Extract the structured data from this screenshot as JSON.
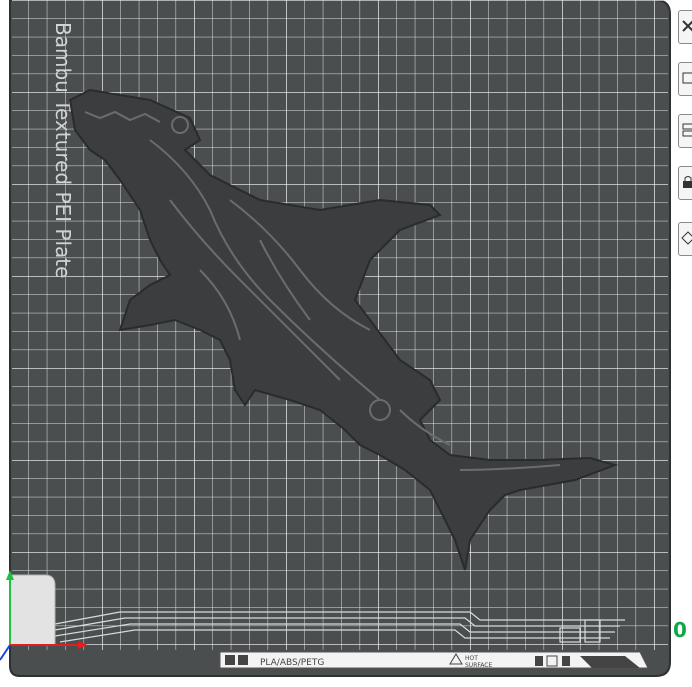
{
  "plate": {
    "name": "Bambu Textured PEI Plate",
    "filament_types": "PLA/ABS/PETG",
    "hot_label_line1": "HOT",
    "hot_label_line2": "SURFACE",
    "colors": {
      "plate": "#4a4e4f",
      "grid": "#e9eceb",
      "model": "#3c3d3e",
      "model_detail": "#6a6d6e",
      "axis_x": "#e02020",
      "axis_y": "#20c040",
      "axis_z": "#2040e0"
    }
  },
  "model": {
    "name": "shark"
  },
  "right_toolbar": {
    "icons": [
      "view-icon",
      "auto-arrange-icon",
      "layers-icon",
      "lock-icon",
      "orient-icon"
    ]
  },
  "status": {
    "zero_value": "0"
  }
}
